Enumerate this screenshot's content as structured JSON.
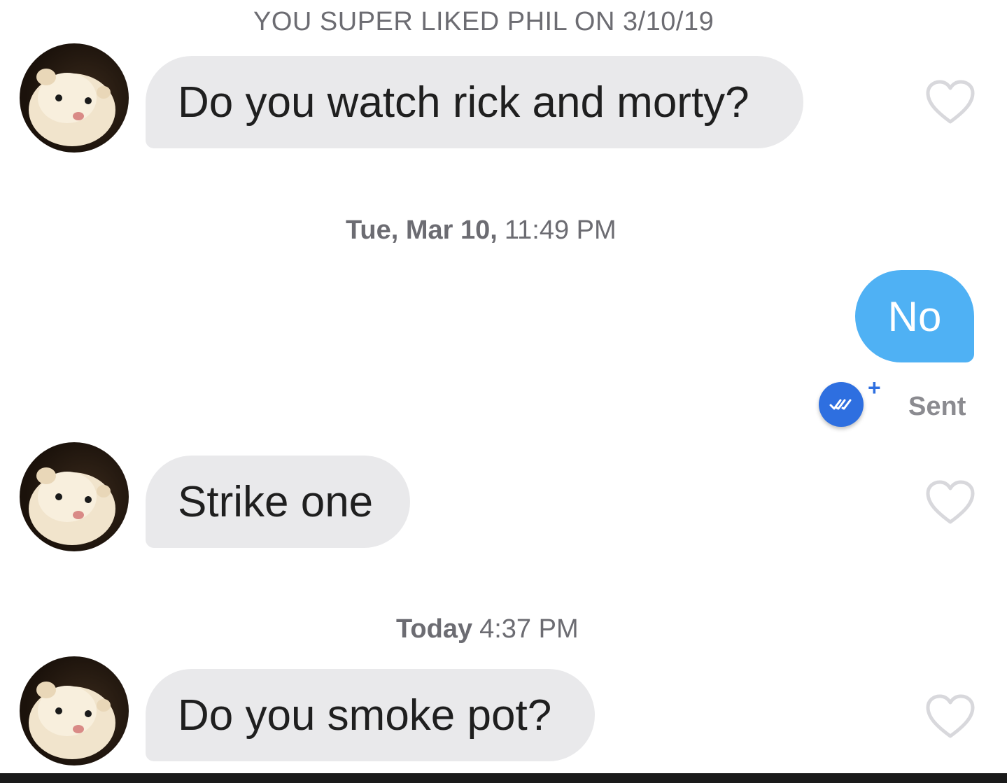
{
  "header": {
    "super_like_text": "YOU SUPER LIKED PHIL ON 3/10/19"
  },
  "messages": [
    {
      "from": "them",
      "text": "Do you watch rick and morty?"
    },
    {
      "from": "me",
      "text": "No",
      "status": "Sent"
    },
    {
      "from": "them",
      "text": "Strike one"
    },
    {
      "from": "them",
      "text": "Do you smoke pot?"
    }
  ],
  "timestamps": [
    {
      "day": "Tue, Mar 10,",
      "time": "11:49 PM"
    },
    {
      "day": "Today",
      "time": "4:37 PM"
    }
  ],
  "read_receipt": {
    "plus": "+"
  },
  "icons": {
    "like": "heart-outline-icon",
    "avatar": "ferret-avatar",
    "read_receipt": "double-check-icon"
  },
  "colors": {
    "incoming_bubble": "#e9e9eb",
    "outgoing_bubble": "#4fb1f4",
    "read_badge": "#2e6fe0",
    "meta_text": "#6c6c72"
  }
}
